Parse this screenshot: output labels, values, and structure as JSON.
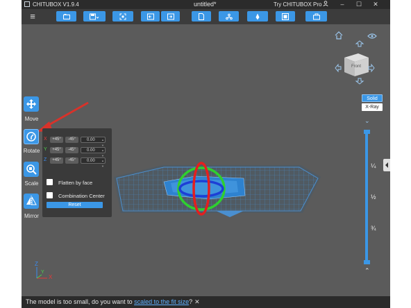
{
  "titlebar": {
    "app_name": "CHITUBOX V1.9.4",
    "document_title": "untitled*",
    "try_pro": "Try CHITUBOX Pro"
  },
  "toolbar": {
    "icons": [
      "open-file-icon",
      "save-icon",
      "screenshot-icon",
      "undo-icon",
      "redo-icon",
      "page-icon",
      "network-icon",
      "support-icon",
      "slice-icon",
      "import-icon"
    ]
  },
  "sidebar": {
    "items": [
      {
        "label": "Move",
        "icon": "move-icon"
      },
      {
        "label": "Rotate",
        "icon": "rotate-icon"
      },
      {
        "label": "Scale",
        "icon": "scale-icon"
      },
      {
        "label": "Mirror",
        "icon": "mirror-icon"
      }
    ]
  },
  "rotate_panel": {
    "rows": [
      {
        "axis": "X",
        "plus": "+45°",
        "minus": "-45°",
        "value": "0.00",
        "color": "#e53a3a"
      },
      {
        "axis": "Y",
        "plus": "+45°",
        "minus": "-45°",
        "value": "0.00",
        "color": "#4dd24d"
      },
      {
        "axis": "Z",
        "plus": "+45°",
        "minus": "-45°",
        "value": "0.00",
        "color": "#3a8cf0"
      }
    ],
    "flatten_label": "Flatten by face",
    "combination_label": "Combination Center",
    "reset_label": "Reset"
  },
  "view": {
    "cube_face": "Front",
    "solid_label": "Solid",
    "xray_label": "X-Ray"
  },
  "slider": {
    "marks": [
      "¼",
      "½",
      "¾"
    ]
  },
  "axes_gizmo": {
    "x": "X",
    "y": "Y",
    "z": "Z"
  },
  "status": {
    "text_before": "The model is too small, do you want to ",
    "link": "scaled to the fit size",
    "text_after": "?",
    "close": "✕"
  },
  "colors": {
    "accent": "#3b97e6",
    "annotation_arrow": "#d8322a",
    "plate": "#3e7fb8"
  }
}
